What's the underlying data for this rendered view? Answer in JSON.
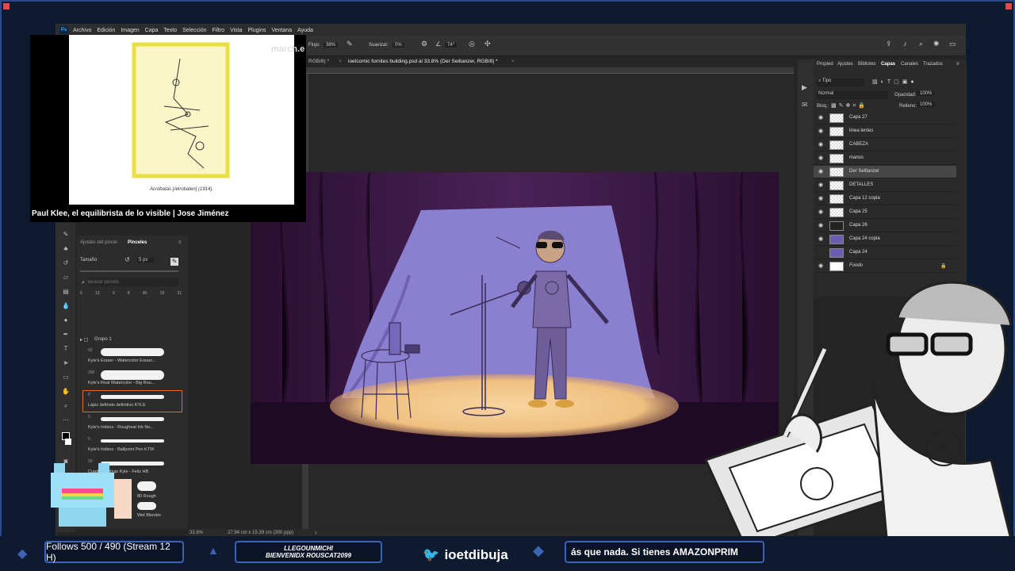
{
  "stream": {
    "follows": "Follows 500 / 490 (Stream 12 H)",
    "welcome_line1": "LLEGOUNMICHI",
    "welcome_line2": "BIENVENIDX ROUSCAT2099",
    "twitter_handle": "ioetdibuja",
    "ticker": "ás que nada. Si tienes AMAZONPRIM"
  },
  "browser_overlay": {
    "title": "Paul Klee, el equilibrista de lo visible | Jose Jiménez",
    "caption": "Acróbatas [Akrobaten] (1914).",
    "site": "march.e"
  },
  "menubar": {
    "logo": "Ps",
    "items": [
      "Archivo",
      "Edición",
      "Imagen",
      "Capa",
      "Texto",
      "Selección",
      "Filtro",
      "Vista",
      "Plugins",
      "Ventana",
      "Ayuda"
    ]
  },
  "options": {
    "flujo_label": "Flujo:",
    "flujo_value": "38%",
    "suavizar_label": "Suavizar:",
    "suavizar_value": "0%",
    "angle_value": "74°"
  },
  "tabs": [
    {
      "label": "RGB/8) *"
    },
    {
      "label": "ioetcomic fornites building.psd al 33.8% (Der Seiltanzer, RGB/8) *"
    }
  ],
  "status": {
    "zoom": "33.8%",
    "doc_size": "27.94 cm x 15.39 cm (300 ppp)"
  },
  "brushes_panel": {
    "tab_settings": "Ajustes del pincel",
    "tab_brushes": "Pinceles",
    "size_label": "Tamaño",
    "size_value": "5 px",
    "search_placeholder": "Buscar pincels",
    "group_name": "Grupo 1",
    "presets": [
      "5",
      "13",
      "9",
      "8",
      "80",
      "19",
      "21"
    ],
    "brushes": [
      {
        "size": "50",
        "label": "Kyle's Eraser - Watercolor Eraser..."
      },
      {
        "size": "250",
        "label": "Kyle's Real Watercolor - Big Rou..."
      },
      {
        "size": "8",
        "label": "Lápiz definido definitivo KYLE"
      },
      {
        "size": "5",
        "label": "Kyle's Inkbox - Rougheat Ink No..."
      },
      {
        "size": "5",
        "label": "Kyle's Inkbox - Ballpoint Pen KTW"
      },
      {
        "size": "50",
        "label": "Cuad... - Dibujo Kyle - Feliz HB"
      },
      {
        "size": "",
        "label": "80 Rough"
      },
      {
        "size": "",
        "label": "Wet Blender"
      }
    ]
  },
  "right_panel": {
    "tabs": [
      "Propied",
      "Ajustes",
      "Bibliotec",
      "Capas",
      "Canales",
      "Trazados"
    ],
    "filter_label": "Tipo",
    "blend_mode": "Normal",
    "opacity_label": "Opacidad:",
    "opacity_value": "100%",
    "lock_label": "Bloq.:",
    "fill_label": "Relleno:",
    "fill_value": "100%",
    "layers": [
      {
        "name": "Capa 27",
        "visible": true,
        "selected": false
      },
      {
        "name": "linea lentes",
        "visible": true,
        "selected": false
      },
      {
        "name": "CABEZA",
        "visible": true,
        "selected": false
      },
      {
        "name": "manos",
        "visible": true,
        "selected": false
      },
      {
        "name": "Der Seiltanzer",
        "visible": true,
        "selected": true
      },
      {
        "name": "DETALLES",
        "visible": true,
        "selected": false
      },
      {
        "name": "Capa 12 copia",
        "visible": true,
        "selected": false
      },
      {
        "name": "Capa 25",
        "visible": true,
        "selected": false
      },
      {
        "name": "Capa 26",
        "visible": true,
        "selected": false
      },
      {
        "name": "Capa 24 copia",
        "visible": true,
        "selected": false
      },
      {
        "name": "Capa 24",
        "visible": false,
        "selected": false
      },
      {
        "name": "Fondo",
        "visible": true,
        "selected": false
      }
    ]
  },
  "colors": {
    "accent": "#3d63b5",
    "selected_brush": "#e8672a",
    "stage_purple": "#8b7fd0",
    "spotlight": "#f4c98a",
    "curtain": "#3a1840"
  }
}
